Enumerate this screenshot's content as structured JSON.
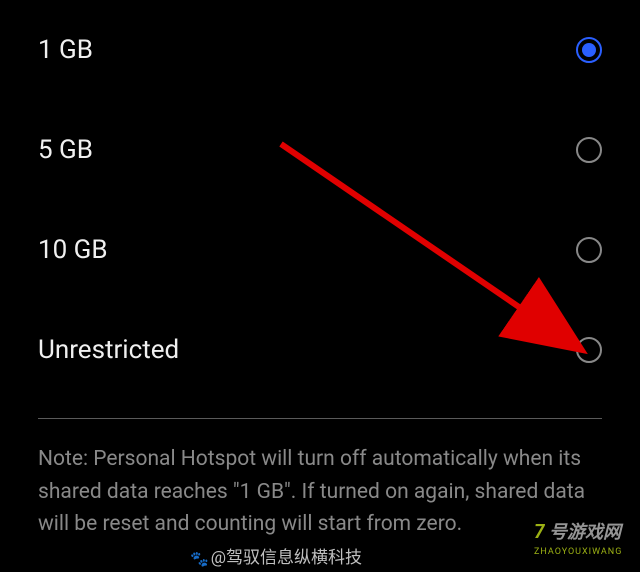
{
  "options": [
    {
      "label": "1 GB",
      "selected": true
    },
    {
      "label": "5 GB",
      "selected": false
    },
    {
      "label": "10 GB",
      "selected": false
    },
    {
      "label": "Unrestricted",
      "selected": false
    }
  ],
  "note": "Note: Personal Hotspot will turn off automatically when its shared data reaches \"1 GB\". If turned on again, shared data will be reset and counting will start from zero.",
  "watermark_left_text": "@驾驭信息纵横科技",
  "watermark_right": {
    "top": "7号游戏网",
    "bottom": "ZHAOYOUXIWANG"
  }
}
